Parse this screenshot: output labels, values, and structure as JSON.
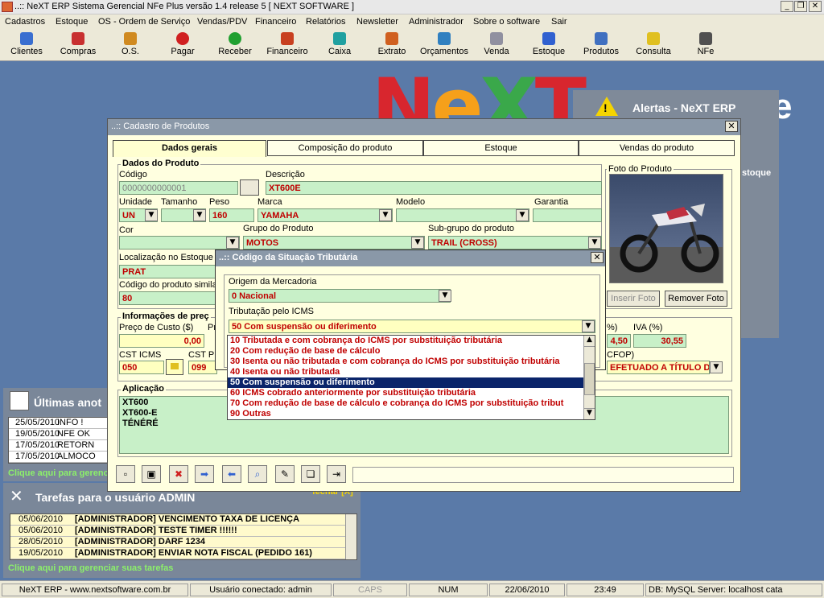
{
  "window": {
    "title": "..:: NeXT ERP Sistema Gerencial NFe Plus versão 1.4 release 5  [ NEXT SOFTWARE ]"
  },
  "menu": [
    "Cadastros",
    "Estoque",
    "OS - Ordem de Serviço",
    "Vendas/PDV",
    "Financeiro",
    "Relatórios",
    "Newsletter",
    "Administrador",
    "Sobre o software",
    "Sair"
  ],
  "toolbar": [
    {
      "label": "Clientes",
      "icon": "users-icon",
      "color": "#3a6fd0"
    },
    {
      "label": "Compras",
      "icon": "cart-icon",
      "color": "#c83030"
    },
    {
      "label": "O.S.",
      "icon": "tools-icon",
      "color": "#d08a20"
    },
    {
      "label": "Pagar",
      "icon": "stop-icon",
      "color": "#d02020"
    },
    {
      "label": "Receber",
      "icon": "plus-icon",
      "color": "#20a030"
    },
    {
      "label": "Financeiro",
      "icon": "money-icon",
      "color": "#c84020"
    },
    {
      "label": "Caixa",
      "icon": "cashbox-icon",
      "color": "#20a0a0"
    },
    {
      "label": "Extrato",
      "icon": "statement-icon",
      "color": "#d06020"
    },
    {
      "label": "Orçamentos",
      "icon": "quote-icon",
      "color": "#3080c0"
    },
    {
      "label": "Venda",
      "icon": "sale-icon",
      "color": "#9090a0"
    },
    {
      "label": "Estoque",
      "icon": "chart-icon",
      "color": "#3060d0"
    },
    {
      "label": "Produtos",
      "icon": "products-icon",
      "color": "#4070c0"
    },
    {
      "label": "Consulta",
      "icon": "folder-icon",
      "color": "#e0c020"
    },
    {
      "label": "NFe",
      "icon": "traffic-light-icon",
      "color": "#505050"
    }
  ],
  "alerts": {
    "title": "Alertas - NeXT ERP",
    "snippet": "stoque"
  },
  "notes": {
    "title": "Últimas anot",
    "rows": [
      [
        "25/05/2010",
        "INFO !"
      ],
      [
        "19/05/2010",
        "NFE OK"
      ],
      [
        "17/05/2010",
        "RETORN"
      ],
      [
        "17/05/2010",
        "ALMOCO"
      ]
    ],
    "link": "Clique aqui para gerenci"
  },
  "tasks": {
    "title": "Tarefas para o usuário ADMIN",
    "close": "fechar [X]",
    "rows": [
      [
        "05/06/2010",
        "[ADMINISTRADOR] VENCIMENTO TAXA DE LICENÇA"
      ],
      [
        "05/06/2010",
        "[ADMINISTRADOR] TESTE TIMER !!!!!!"
      ],
      [
        "28/05/2010",
        "[ADMINISTRADOR] DARF 1234"
      ],
      [
        "19/05/2010",
        "[ADMINISTRADOR] ENVIAR NOTA FISCAL (PEDIDO 161)"
      ]
    ],
    "link": "Clique aqui para gerenciar suas tarefas"
  },
  "status": [
    "NeXT ERP - www.nextsoftware.com.br",
    "Usuário conectado: admin",
    "CAPS",
    "NUM",
    "22/06/2010",
    "23:49",
    "DB: MySQL Server: localhost cata"
  ],
  "product": {
    "title": "..:: Cadastro de Produtos",
    "tabs": [
      "Dados gerais",
      "Composição do produto",
      "Estoque",
      "Vendas do produto"
    ],
    "section_title": "Dados do Produto",
    "codigo": {
      "label": "Código",
      "value": "0000000000001"
    },
    "descricao": {
      "label": "Descrição",
      "value": "XT600E"
    },
    "unidade": {
      "label": "Unidade",
      "value": "UN"
    },
    "tamanho": {
      "label": "Tamanho",
      "value": ""
    },
    "peso": {
      "label": "Peso",
      "value": "160"
    },
    "marca": {
      "label": "Marca",
      "value": "YAMAHA"
    },
    "modelo": {
      "label": "Modelo",
      "value": ""
    },
    "garantia": {
      "label": "Garantia",
      "value": ""
    },
    "cor": {
      "label": "Cor",
      "value": ""
    },
    "grupo": {
      "label": "Grupo do Produto",
      "value": "MOTOS"
    },
    "subgrupo": {
      "label": "Sub-grupo do produto",
      "value": "TRAIL (CROSS)"
    },
    "localizacao": {
      "label": "Localização no Estoque",
      "value": "PRAT"
    },
    "similar": {
      "label": "Código do produto similar",
      "value": "80"
    },
    "photo_label": "Foto do Produto",
    "insert_photo": "Inserir Foto",
    "remove_photo": "Remover Foto",
    "prices_title": "Informações de preç",
    "custo": {
      "label": "Preço de Custo ($)",
      "value": "0,00"
    },
    "pr_label": "Pr",
    "pct_label": "%)",
    "pct_value": "4,50",
    "iva": {
      "label": "IVA (%)",
      "value": "30,55"
    },
    "cst_icms": {
      "label": "CST ICMS",
      "value": "050"
    },
    "cst_pis": {
      "label": "CST PIS",
      "value": "099"
    },
    "cfop_label": "CFOP)",
    "cfop_value": "EFETUADO A TÍTULO DE",
    "aplicacao_title": "Aplicação",
    "aplicacao": [
      "XT600",
      "XT600-E",
      "TÉNÉRÉ"
    ]
  },
  "cst_dialog": {
    "title": "..:: Código da Situação Tributária",
    "origem_label": "Origem da Mercadoria",
    "origem_value": "0 Nacional",
    "icms_label": "Tributação pelo ICMS",
    "icms_value": "50 Com suspensão ou diferimento",
    "options": [
      "10 Tributada e com cobrança do ICMS por substituição tributária",
      "20 Com redução de base de cálculo",
      "30 Isenta ou não tributada e com cobrança do ICMS por substituição tributária",
      "40 Isenta ou não tributada",
      "50 Com suspensão ou diferimento",
      "60 ICMS cobrado anteriormente por substituição tributária",
      "70 Com redução de base de cálculo e cobrança do ICMS por substituição tribut",
      "90 Outras"
    ],
    "selected_index": 4
  }
}
